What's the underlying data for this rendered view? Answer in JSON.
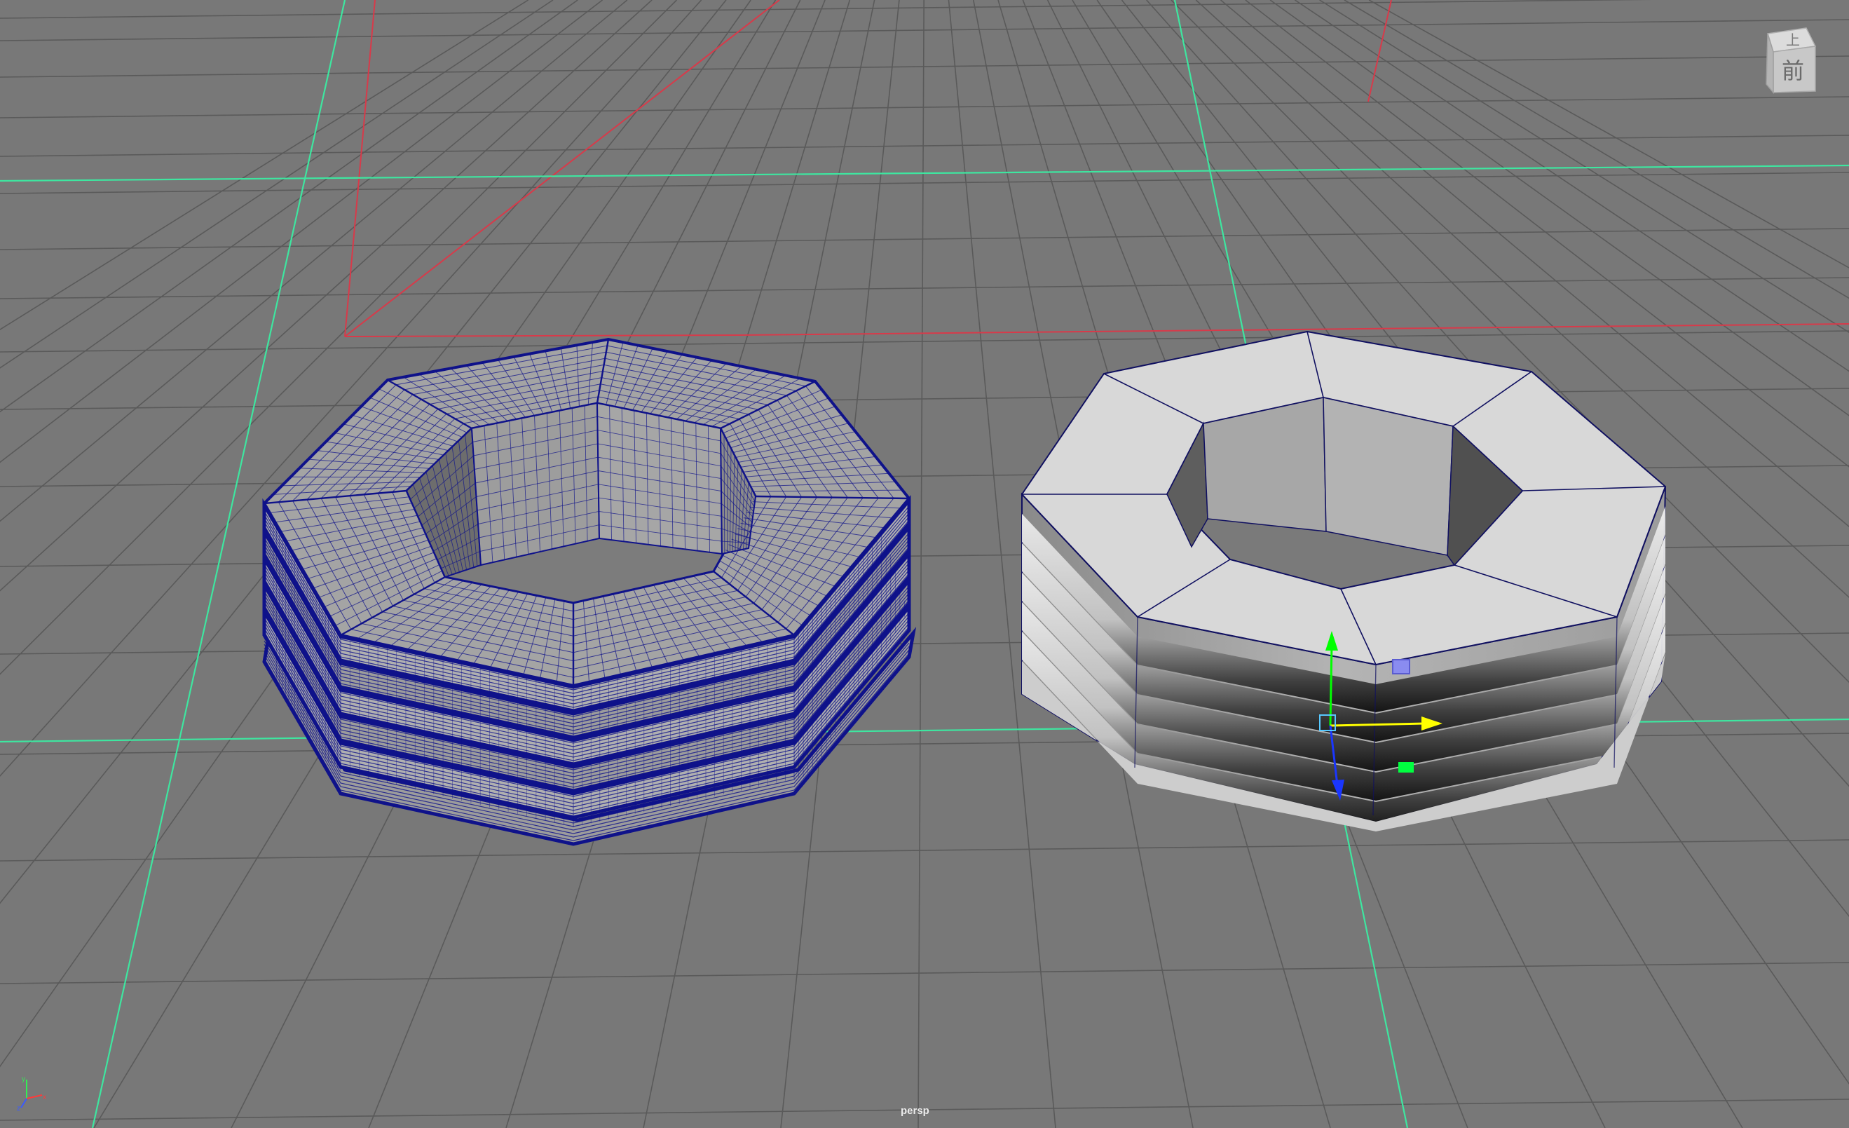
{
  "viewport": {
    "camera_name": "persp",
    "view_cube": {
      "top_label": "上",
      "front_label": "前"
    }
  },
  "colors": {
    "background": "#787878",
    "grid": "#5a5a5a",
    "grid_axis_green": "#3ee6a0",
    "grid_axis_red": "#d83a4a",
    "wire_blue": "#0f128a",
    "manip_x": "#ffff00",
    "manip_y": "#00ff00",
    "manip_z": "#1a36ff"
  },
  "objects": [
    {
      "name": "wireframe-mesh",
      "display": "wireframe-on-shaded",
      "bands": 6
    },
    {
      "name": "shaded-mesh",
      "display": "shaded",
      "bands": 5,
      "selected": true
    }
  ],
  "icons": {
    "axis_indicator": "xyz-axis-icon",
    "manipulator": "move-manipulator-icon",
    "view_cube": "view-cube-icon"
  }
}
